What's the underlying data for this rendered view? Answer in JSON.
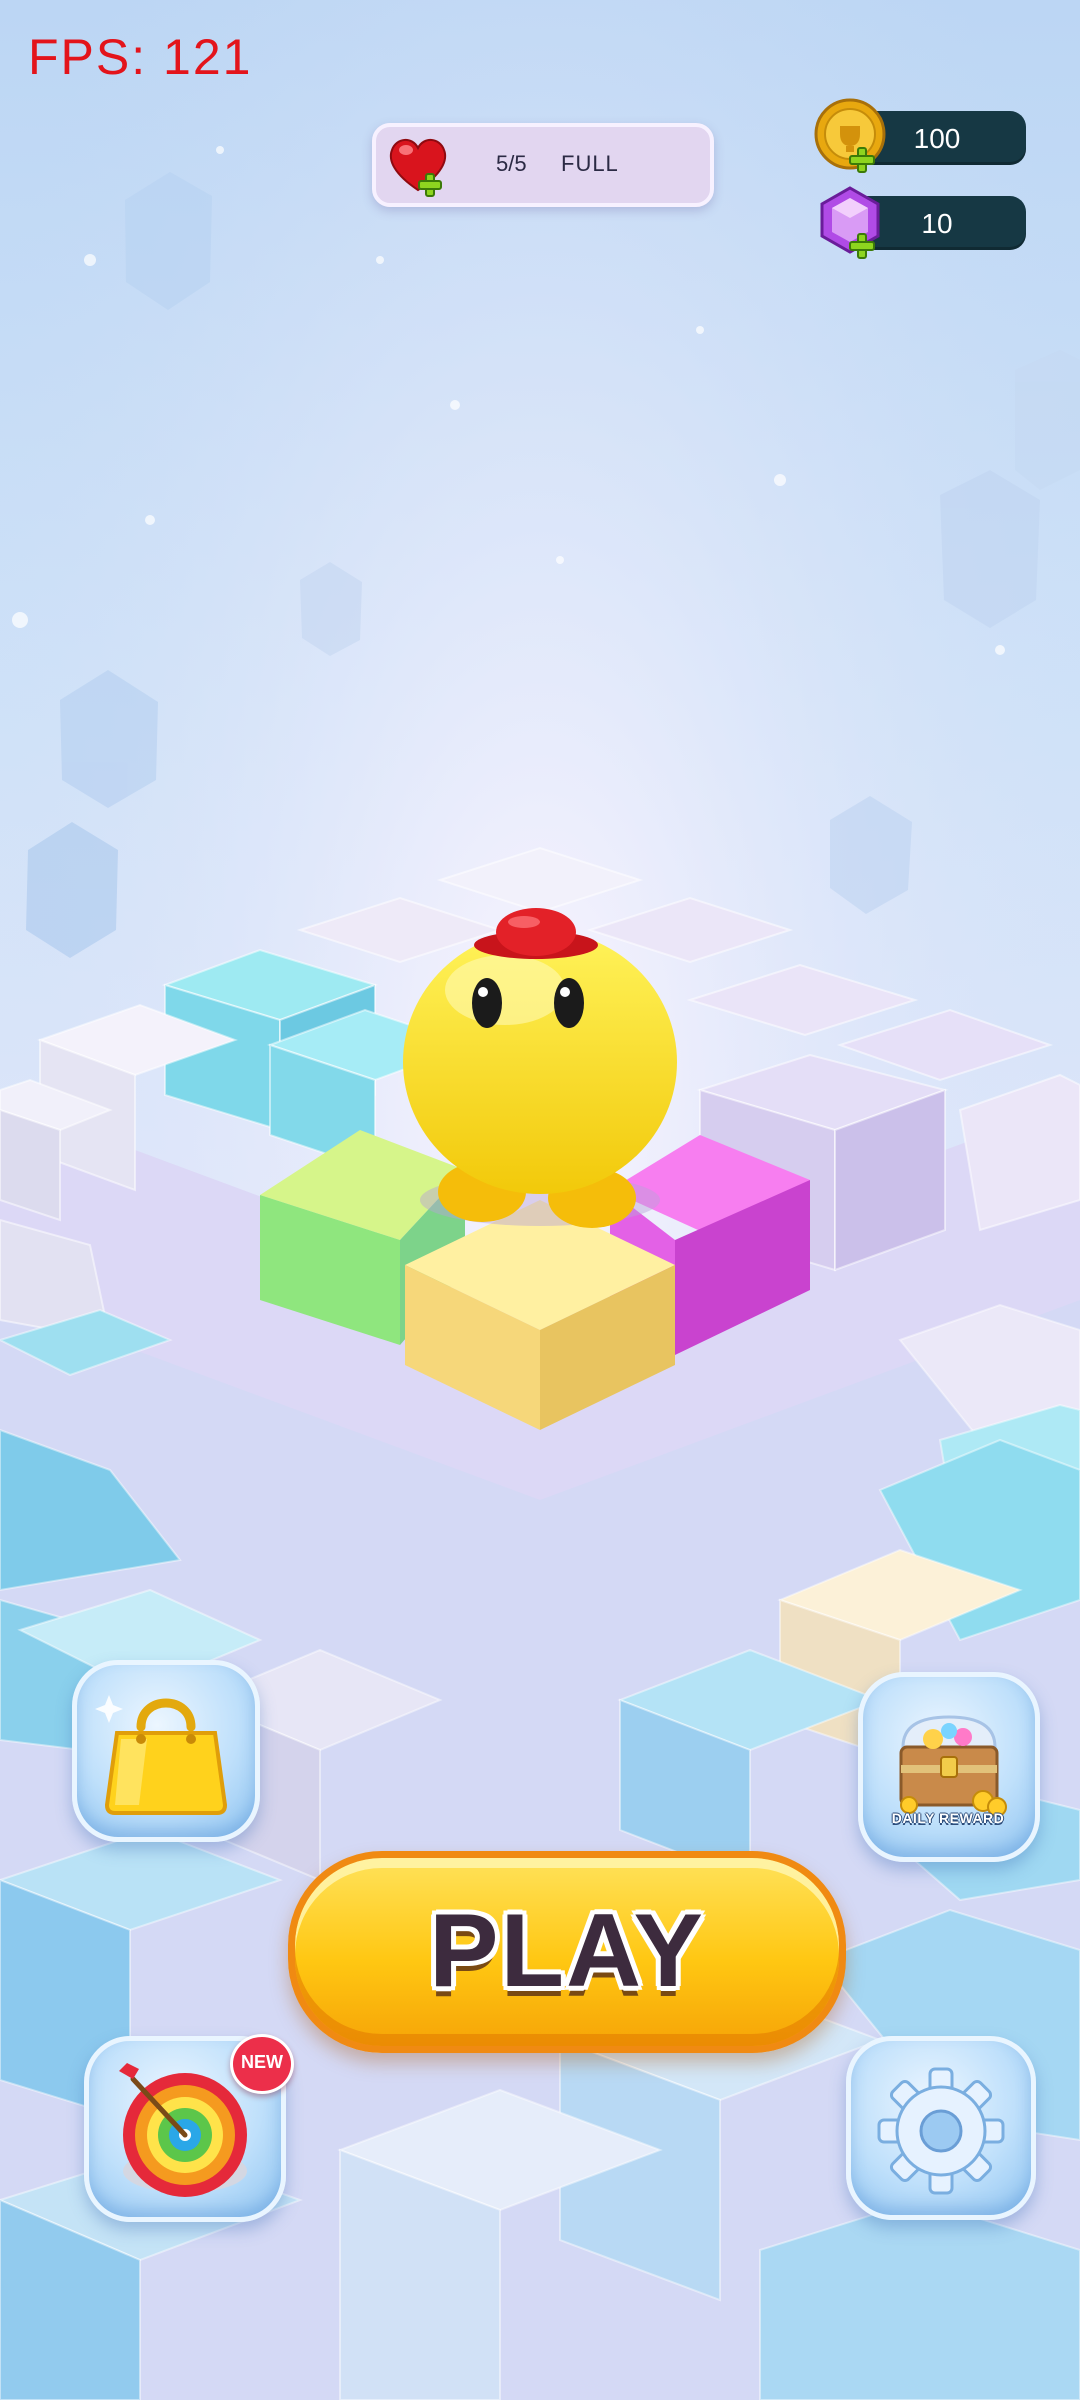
{
  "hud": {
    "fps": "FPS: 121",
    "lives": {
      "count": "5/5",
      "status": "FULL",
      "icon": "heart-plus-icon"
    },
    "coins": {
      "value": "100",
      "icon": "gold-coin-plus-icon"
    },
    "gems": {
      "value": "10",
      "icon": "purple-gem-plus-icon"
    }
  },
  "buttons": {
    "shop": {
      "icon": "shopping-bag-icon"
    },
    "daily_reward": {
      "label": "DAILY REWARD",
      "icon": "treasure-chest-icon"
    },
    "play": {
      "label": "PLAY"
    },
    "target": {
      "icon": "dartboard-icon",
      "badge": "NEW"
    },
    "settings": {
      "icon": "gear-icon"
    }
  },
  "scene": {
    "character": "yellow-blob-with-red-hat",
    "highlight_tiles": [
      "green",
      "yellow",
      "magenta"
    ]
  },
  "colors": {
    "fps_text": "#e3141b",
    "play_button": "#ffc712",
    "play_border": "#f08a12",
    "badge": "#ec2f4a",
    "resource_bar": "#163844"
  }
}
